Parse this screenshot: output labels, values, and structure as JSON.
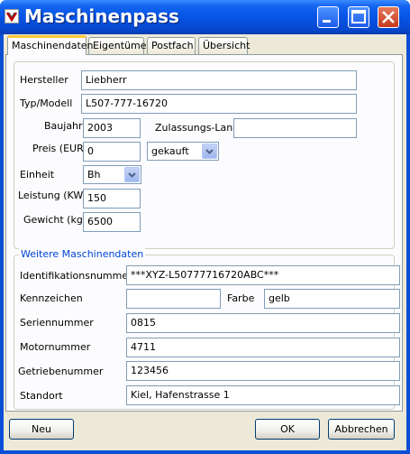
{
  "window": {
    "title": "Maschinenpass",
    "controls": {
      "minimize": "minimize",
      "maximize": "maximize",
      "close": "close"
    }
  },
  "tabs": [
    {
      "label": "Maschinendaten",
      "active": true
    },
    {
      "label": "Eigentümer",
      "active": false
    },
    {
      "label": "Postfach",
      "active": false
    },
    {
      "label": "Übersicht",
      "active": false
    }
  ],
  "main": {
    "hersteller_label": "Hersteller",
    "hersteller_value": "Liebherr",
    "typ_label": "Typ/Modell",
    "typ_value": "L507-777-16720",
    "baujahr_label": "Baujahr",
    "baujahr_value": "2003",
    "zulassung_label": "Zulassungs-Land",
    "zulassung_value": "",
    "preis_label": "Preis (EUR)",
    "preis_value": "0",
    "kaufart_value": "gekauft",
    "einheit_label": "Einheit",
    "einheit_value": "Bh",
    "leistung_label": "Leistung (KW)",
    "leistung_value": "150",
    "gewicht_label": "Gewicht (kg)",
    "gewicht_value": "6500"
  },
  "weitere": {
    "legend": "Weitere Maschinendaten",
    "ident_label": "Identifikationsnummer",
    "ident_value": "***XYZ-L50777716720ABC***",
    "kennzeichen_label": "Kennzeichen",
    "kennzeichen_value": "",
    "farbe_label": "Farbe",
    "farbe_value": "gelb",
    "serien_label": "Seriennummer",
    "serien_value": "0815",
    "motor_label": "Motornummer",
    "motor_value": "4711",
    "getriebe_label": "Getriebenummer",
    "getriebe_value": "123456",
    "standort_label": "Standort",
    "standort_value": "Kiel, Hafenstrasse 1"
  },
  "buttons": {
    "neu": "Neu",
    "ok": "OK",
    "abbrechen": "Abbrechen"
  },
  "colors": {
    "titlebar": "#0648d0",
    "legend": "#0046d5",
    "tab_highlight": "#ffc83c",
    "close_button": "#c5391a"
  }
}
